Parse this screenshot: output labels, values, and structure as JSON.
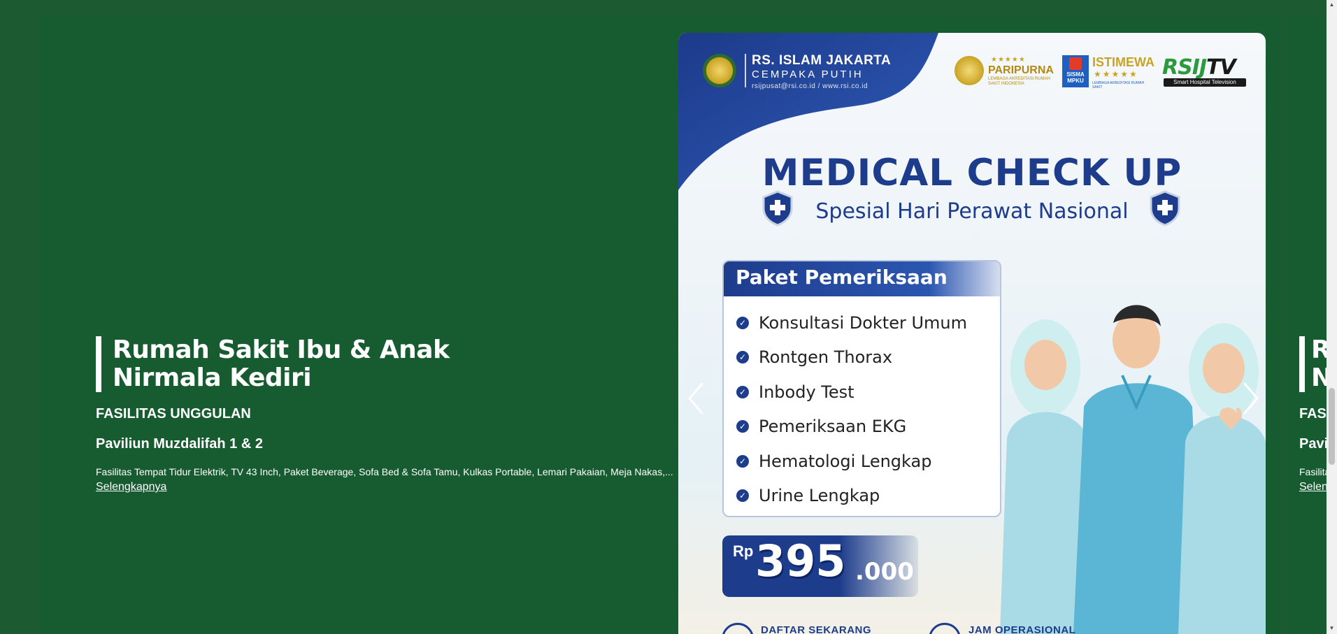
{
  "slide": {
    "title_line1": "Rumah Sakit Ibu & Anak",
    "title_line2": "Nirmala Kediri",
    "section_label": "FASILITAS UNGGULAN",
    "item_title": "Paviliun Muzdalifah 1 & 2",
    "item_description": "Fasilitas Tempat Tidur Elektrik, TV 43 Inch, Paket Beverage, Sofa Bed & Sofa Tamu, Kulkas Portable, Lemari Pakaian, Meja Nakas,...",
    "more_link": "Selengkapnya"
  },
  "next_slide_peek": {
    "title_line1": "R",
    "title_line2": "N",
    "section_label": "FASI",
    "item_title": "Pavil",
    "item_description": "Fasilitas",
    "more_link": "Seleng"
  },
  "poster": {
    "hospital_name": "RS. ISLAM JAKARTA",
    "hospital_branch": "CEMPAKA PUTIH",
    "hospital_contact": "rsijpusat@rsi.co.id / www.rsi.co.id",
    "badge_paripurna": {
      "stars": "★★★★★",
      "label": "PARIPURNA",
      "sub": "LEMBAGA AKREDITASI RUMAH SAKIT INDONESIA"
    },
    "badge_istimewa": {
      "label": "ISTIMEWA",
      "stars": "★★★★★",
      "box_text": "SISMA MPKU",
      "sub": "LEMBAGA AKREDITASI RUMAH SAKIT"
    },
    "rsijtv": {
      "main": "RSIJ",
      "tv": "TV",
      "sub": "Smart Hospital Television"
    },
    "headline": "MEDICAL CHECK UP",
    "subheadline": "Spesial Hari Perawat Nasional",
    "package_title": "Paket Pemeriksaan",
    "package_items": [
      "Konsultasi Dokter Umum",
      "Rontgen Thorax",
      "Inbody Test",
      "Pemeriksaan EKG",
      "Hematologi Lengkap",
      "Urine Lengkap"
    ],
    "price_currency": "Rp",
    "price_main": "395",
    "price_cents": ".000",
    "cta_register": "DAFTAR SEKARANG",
    "cta_hours": "JAM OPERASIONAL"
  },
  "colors": {
    "page_bg": "#1c5a32",
    "slide_bg": "#175b31",
    "poster_blue": "#1e3c8c",
    "gold": "#c9a423"
  },
  "icons": {
    "prev": "chevron-left-icon",
    "next": "chevron-right-icon",
    "check": "check-icon",
    "shield": "shield-cross-icon"
  }
}
